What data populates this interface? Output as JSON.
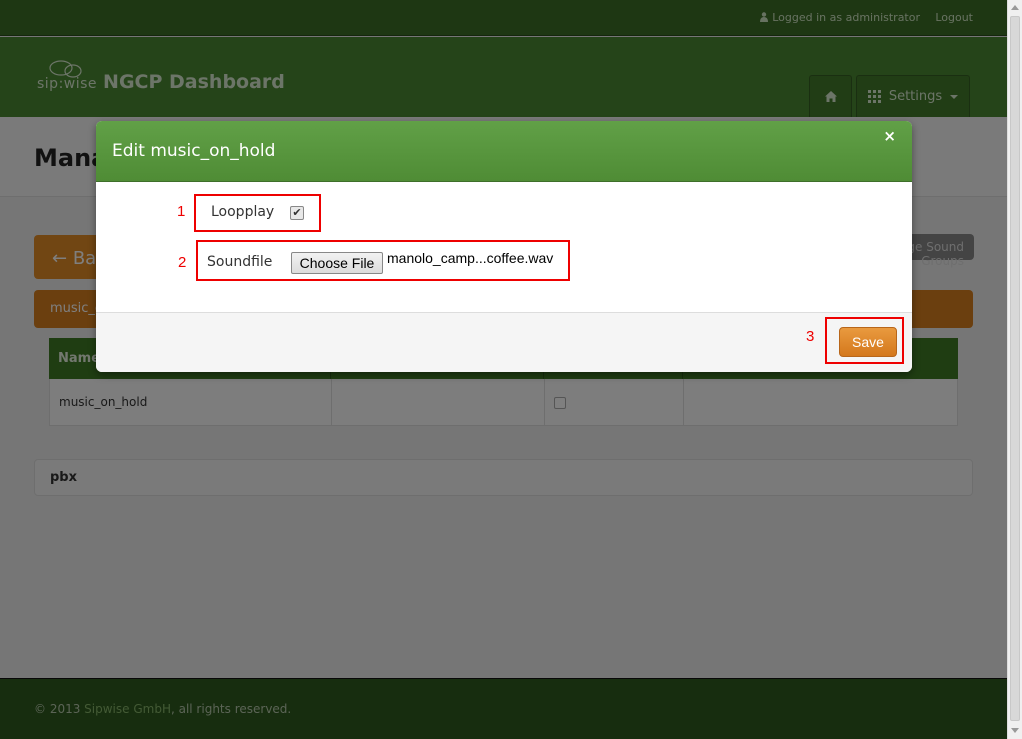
{
  "topbar": {
    "user_text": "Logged in as administrator",
    "logout_label": "Logout"
  },
  "navbar": {
    "brand_logo": "sip:wise",
    "brand_title": "NGCP Dashboard",
    "home_icon": "home-icon",
    "settings_label": "Settings"
  },
  "page": {
    "title": "Manage",
    "back_label": "Back",
    "groups_label": "Manage Sound Groups",
    "accordion_label": "music_on_hold",
    "table": {
      "headers": [
        "Name",
        "",
        "",
        ""
      ],
      "rows": [
        {
          "name": "music_on_hold",
          "col2": "",
          "loopplay": false,
          "col4": ""
        }
      ]
    },
    "pbx_label": "pbx"
  },
  "footer": {
    "copyright_prefix": "© 2013 ",
    "company_link": "Sipwise GmbH",
    "copyright_suffix": ", all rights reserved."
  },
  "modal": {
    "title": "Edit music_on_hold",
    "close_label": "×",
    "fields": {
      "loopplay_label": "Loopplay",
      "loopplay_checked": true,
      "soundfile_label": "Soundfile",
      "choose_file_label": "Choose File",
      "file_name": "manolo_camp...coffee.wav"
    },
    "save_label": "Save"
  },
  "annotations": [
    "1",
    "2",
    "3"
  ],
  "colors": {
    "brand_green": "#4b8832",
    "accent_orange": "#d67f1f",
    "annotation_red": "#e00000"
  }
}
